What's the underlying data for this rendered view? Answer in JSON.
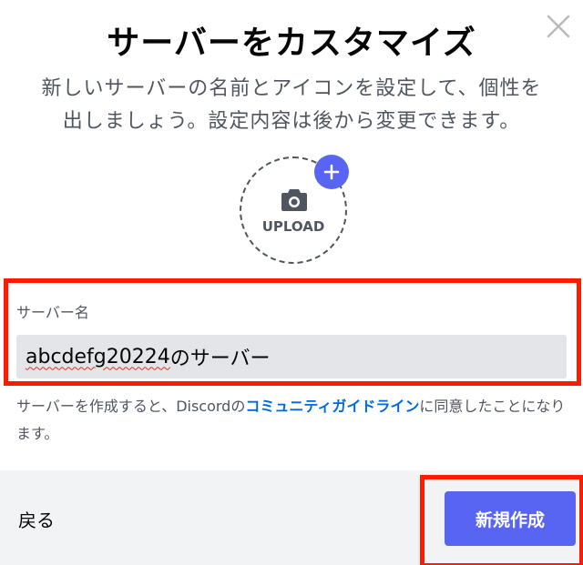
{
  "modal": {
    "title": "サーバーをカスタマイズ",
    "subtitle_line1": "新しいサーバーの名前とアイコンを設定して、個性を",
    "subtitle_line2": "出しましょう。設定内容は後から変更できます。"
  },
  "upload": {
    "label": "UPLOAD",
    "icon": "camera-icon",
    "badge_icon": "plus-icon"
  },
  "server_name": {
    "label": "サーバー名",
    "value_typed": "abcdefg20224",
    "value_suffix": "のサーバー"
  },
  "terms": {
    "prefix": "サーバーを作成すると、Discordの",
    "link": "コミュニティガイドライン",
    "suffix": "に同意したことになります。"
  },
  "footer": {
    "back_label": "戻る",
    "create_label": "新規作成"
  },
  "colors": {
    "brand": "#5865f2",
    "highlight": "#ff1a00",
    "link": "#0068e0"
  }
}
